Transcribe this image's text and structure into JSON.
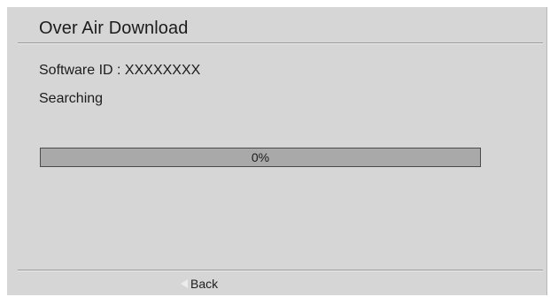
{
  "dialog": {
    "title": "Over Air Download"
  },
  "info": {
    "software_id": "Software ID : XXXXXXXX",
    "status": "Searching"
  },
  "progress": {
    "percent": 0,
    "label": "0%",
    "fill_color": "#4f7fbf",
    "track_color": "#a9a9a9"
  },
  "footer": {
    "back_label": "Back",
    "back_icon": "left-triangle-icon"
  }
}
